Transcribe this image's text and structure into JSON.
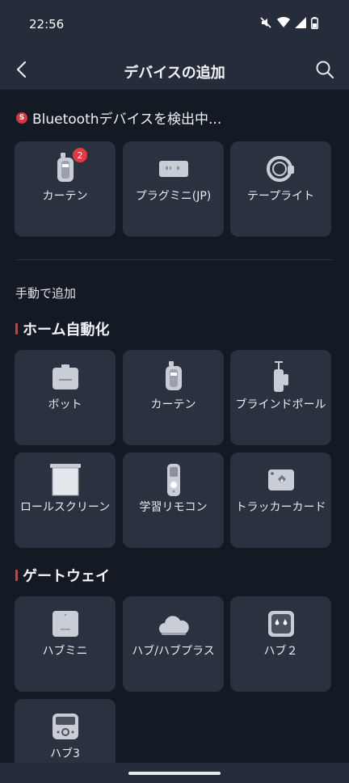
{
  "status_bar": {
    "time": "22:56"
  },
  "header": {
    "title": "デバイスの追加"
  },
  "scanning": {
    "label": "Bluetoothデバイスを検出中...",
    "icon_letter": "S"
  },
  "found_devices": [
    {
      "label": "カーテン",
      "icon": "curtain-icon",
      "badge": "2"
    },
    {
      "label": "プラグミニ(JP)",
      "icon": "plug-mini-icon"
    },
    {
      "label": "テープライト",
      "icon": "tape-light-icon"
    }
  ],
  "manual_add_label": "手動で追加",
  "sections": {
    "home_automation": {
      "title": "ホーム自動化",
      "items": [
        {
          "label": "ボット",
          "icon": "bot-icon"
        },
        {
          "label": "カーテン",
          "icon": "curtain-icon"
        },
        {
          "label": "ブラインドポール",
          "icon": "blind-tilt-icon"
        },
        {
          "label": "ロールスクリーン",
          "icon": "roller-shade-icon"
        },
        {
          "label": "学習リモコン",
          "icon": "remote-icon"
        },
        {
          "label": "トラッカーカード",
          "icon": "tracker-card-icon"
        }
      ]
    },
    "gateway": {
      "title": "ゲートウェイ",
      "items": [
        {
          "label": "ハブミニ",
          "icon": "hub-mini-icon"
        },
        {
          "label": "ハブ/ハブプラス",
          "icon": "hub-plus-icon"
        },
        {
          "label": "ハブ２",
          "icon": "hub-2-icon"
        },
        {
          "label": "ハブ3",
          "icon": "hub-3-icon"
        }
      ]
    }
  },
  "colors": {
    "background": "#141a24",
    "card": "#2a3240",
    "header": "#252d3a",
    "accent": "#e0353d"
  }
}
